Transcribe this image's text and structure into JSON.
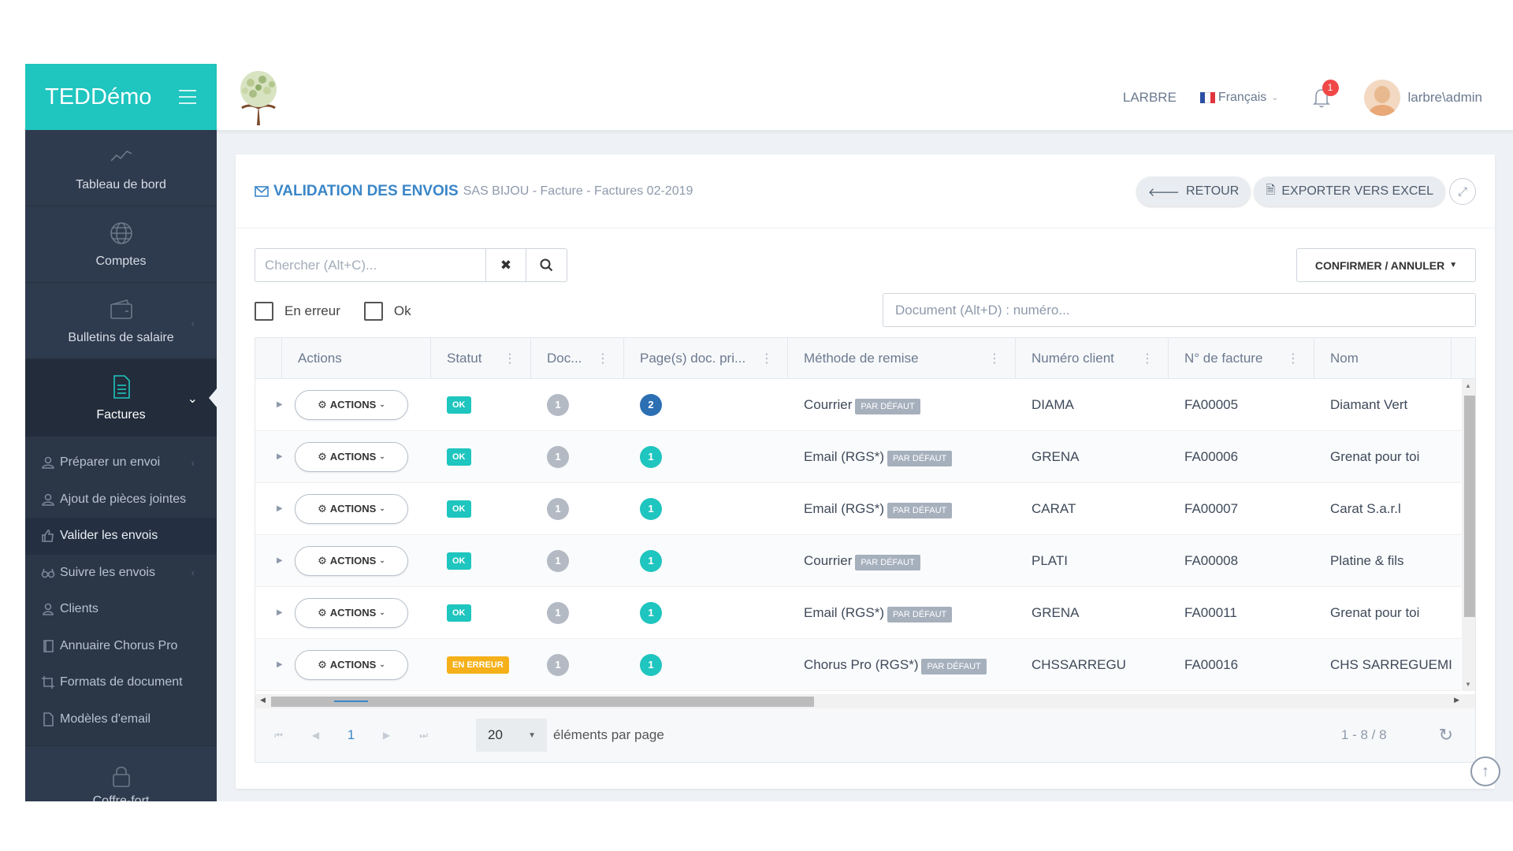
{
  "app": {
    "brand": "TEDDémo"
  },
  "colors": {
    "accent": "#1fc5bf",
    "sidebar": "#2e3a4d",
    "title": "#3a86c8",
    "error": "#f5b01a"
  },
  "sidebar": {
    "main_items": [
      {
        "label": "Tableau de bord",
        "icon": "chart-line-icon"
      },
      {
        "label": "Comptes",
        "icon": "globe-icon"
      },
      {
        "label": "Bulletins de salaire",
        "icon": "wallet-icon"
      },
      {
        "label": "Factures",
        "icon": "document-icon"
      }
    ],
    "sub_items": [
      {
        "label": "Préparer un envoi",
        "icon": "users-icon"
      },
      {
        "label": "Ajout de pièces jointes",
        "icon": "users-icon"
      },
      {
        "label": "Valider les envois",
        "icon": "thumbs-up-icon"
      },
      {
        "label": "Suivre les envois",
        "icon": "glasses-icon"
      },
      {
        "label": "Clients",
        "icon": "user-icon"
      },
      {
        "label": "Annuaire Chorus Pro",
        "icon": "book-icon"
      },
      {
        "label": "Formats de document",
        "icon": "crop-icon"
      },
      {
        "label": "Modèles d'email",
        "icon": "file-icon"
      }
    ],
    "bottom_item": {
      "label": "Coffre-fort",
      "icon": "lock-icon"
    }
  },
  "header": {
    "org": "LARBRE",
    "language": "Français",
    "notifications": "1",
    "user": "larbre\\admin"
  },
  "panel": {
    "title": "VALIDATION DES ENVOIS",
    "subtitle": "SAS BIJOU - Facture - Factures 02-2019",
    "back_label": "RETOUR",
    "export_label": "EXPORTER VERS EXCEL",
    "search_placeholder": "Chercher (Alt+C)...",
    "filter_error": "En erreur",
    "filter_ok": "Ok",
    "confirm_label": "CONFIRMER / ANNULER",
    "doc_placeholder": "Document (Alt+D) : numéro..."
  },
  "table": {
    "columns": [
      "Actions",
      "Statut",
      "Doc...",
      "Page(s) doc. pri...",
      "Méthode de remise",
      "Numéro client",
      "N° de facture",
      "Nom"
    ],
    "action_label": "ACTIONS",
    "default_tag": "PAR DÉFAUT",
    "rows": [
      {
        "status": "OK",
        "status_type": "ok",
        "docs": "1",
        "pages": "2",
        "pages_style": "blue",
        "method": "Courrier",
        "client": "DIAMA",
        "invoice": "FA00005",
        "name": "Diamant Vert"
      },
      {
        "status": "OK",
        "status_type": "ok",
        "docs": "1",
        "pages": "1",
        "pages_style": "teal",
        "method": "Email (RGS*)",
        "client": "GRENA",
        "invoice": "FA00006",
        "name": "Grenat pour toi"
      },
      {
        "status": "OK",
        "status_type": "ok",
        "docs": "1",
        "pages": "1",
        "pages_style": "teal",
        "method": "Email (RGS*)",
        "client": "CARAT",
        "invoice": "FA00007",
        "name": "Carat S.a.r.l"
      },
      {
        "status": "OK",
        "status_type": "ok",
        "docs": "1",
        "pages": "1",
        "pages_style": "teal",
        "method": "Courrier",
        "client": "PLATI",
        "invoice": "FA00008",
        "name": "Platine & fils"
      },
      {
        "status": "OK",
        "status_type": "ok",
        "docs": "1",
        "pages": "1",
        "pages_style": "teal",
        "method": "Email (RGS*)",
        "client": "GRENA",
        "invoice": "FA00011",
        "name": "Grenat pour toi"
      },
      {
        "status": "EN ERREUR",
        "status_type": "err",
        "docs": "1",
        "pages": "1",
        "pages_style": "teal",
        "method": "Chorus Pro (RGS*)",
        "client": "CHSSARREGU",
        "invoice": "FA00016",
        "name": "CHS SARREGUEMIN"
      }
    ]
  },
  "pager": {
    "current_page": "1",
    "page_size": "20",
    "per_page_label": "éléments par page",
    "range": "1 - 8 / 8"
  }
}
